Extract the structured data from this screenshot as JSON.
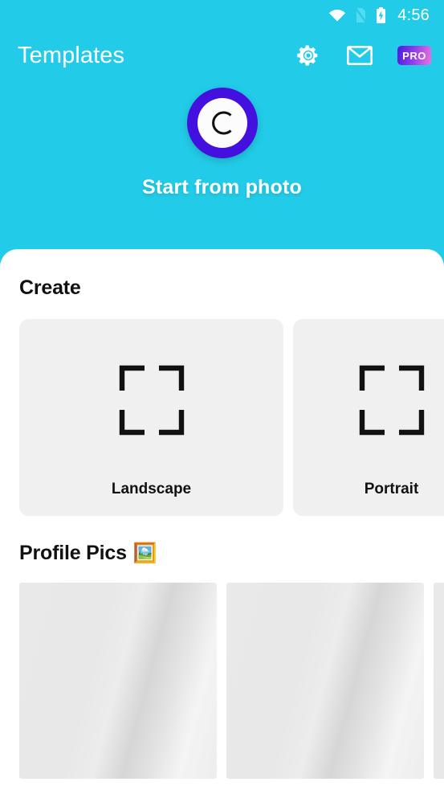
{
  "statusbar": {
    "time": "4:56",
    "icons": [
      "wifi-icon",
      "no-sim-icon",
      "battery-charging-icon"
    ]
  },
  "appbar": {
    "title": "Templates",
    "settings_icon": "gear-icon",
    "mail_icon": "envelope-icon",
    "pro_label": "PRO"
  },
  "hero": {
    "logo_letter": "C",
    "label": "Start from photo",
    "logo_bg_color": "#4310e0",
    "background_color": "#22cce8"
  },
  "create": {
    "title": "Create",
    "cards": [
      {
        "label": "Landscape",
        "icon": "crop-frame-icon"
      },
      {
        "label": "Portrait",
        "icon": "crop-frame-icon"
      }
    ]
  },
  "profile_pics": {
    "title": "Profile Pics",
    "emoji": "🖼️",
    "thumbnails": [
      "placeholder-1",
      "placeholder-2",
      "placeholder-3"
    ]
  }
}
